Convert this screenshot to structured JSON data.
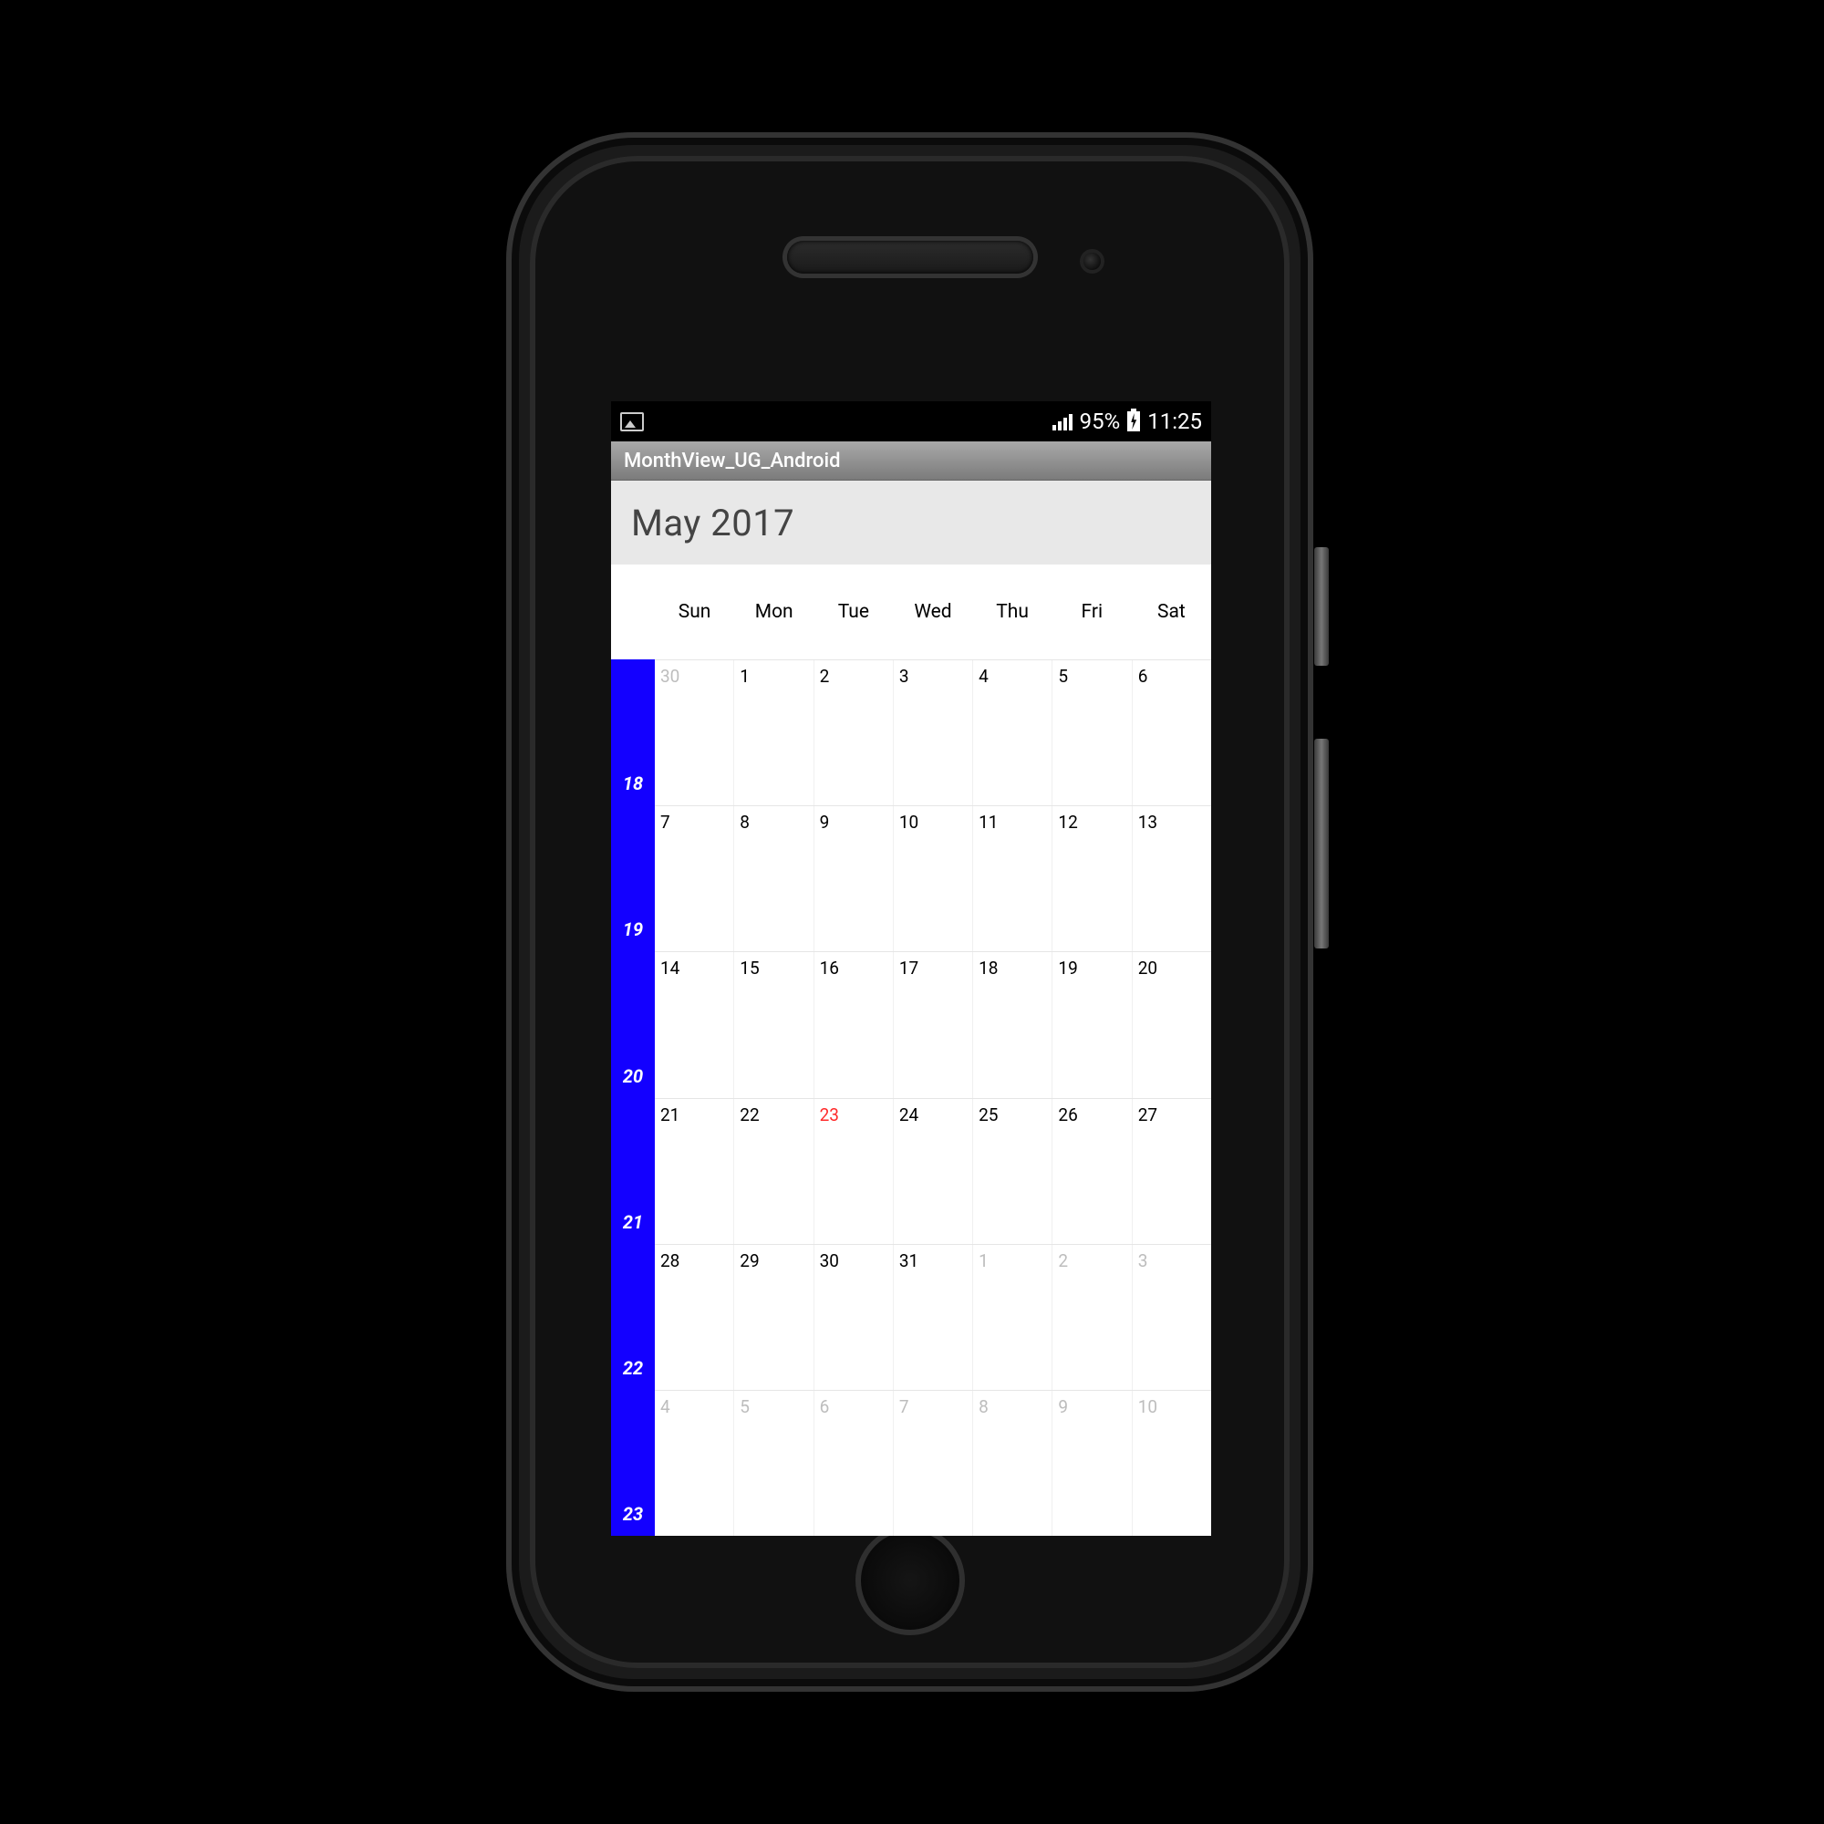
{
  "status_bar": {
    "battery_text": "95%",
    "time": "11:25"
  },
  "title_bar": {
    "title": "MonthView_UG_Android"
  },
  "month_header": {
    "label": "May 2017"
  },
  "day_headers": [
    "Sun",
    "Mon",
    "Tue",
    "Wed",
    "Thu",
    "Fri",
    "Sat"
  ],
  "week_numbers": [
    "18",
    "19",
    "20",
    "21",
    "22",
    "23"
  ],
  "weeks": [
    [
      {
        "n": "30",
        "out": true
      },
      {
        "n": "1"
      },
      {
        "n": "2"
      },
      {
        "n": "3"
      },
      {
        "n": "4"
      },
      {
        "n": "5"
      },
      {
        "n": "6"
      }
    ],
    [
      {
        "n": "7"
      },
      {
        "n": "8"
      },
      {
        "n": "9"
      },
      {
        "n": "10"
      },
      {
        "n": "11"
      },
      {
        "n": "12"
      },
      {
        "n": "13"
      }
    ],
    [
      {
        "n": "14"
      },
      {
        "n": "15"
      },
      {
        "n": "16"
      },
      {
        "n": "17"
      },
      {
        "n": "18"
      },
      {
        "n": "19"
      },
      {
        "n": "20"
      }
    ],
    [
      {
        "n": "21"
      },
      {
        "n": "22"
      },
      {
        "n": "23",
        "today": true
      },
      {
        "n": "24"
      },
      {
        "n": "25"
      },
      {
        "n": "26"
      },
      {
        "n": "27"
      }
    ],
    [
      {
        "n": "28"
      },
      {
        "n": "29"
      },
      {
        "n": "30"
      },
      {
        "n": "31"
      },
      {
        "n": "1",
        "out": true
      },
      {
        "n": "2",
        "out": true
      },
      {
        "n": "3",
        "out": true
      }
    ],
    [
      {
        "n": "4",
        "out": true
      },
      {
        "n": "5",
        "out": true
      },
      {
        "n": "6",
        "out": true
      },
      {
        "n": "7",
        "out": true
      },
      {
        "n": "8",
        "out": true
      },
      {
        "n": "9",
        "out": true
      },
      {
        "n": "10",
        "out": true
      }
    ]
  ]
}
